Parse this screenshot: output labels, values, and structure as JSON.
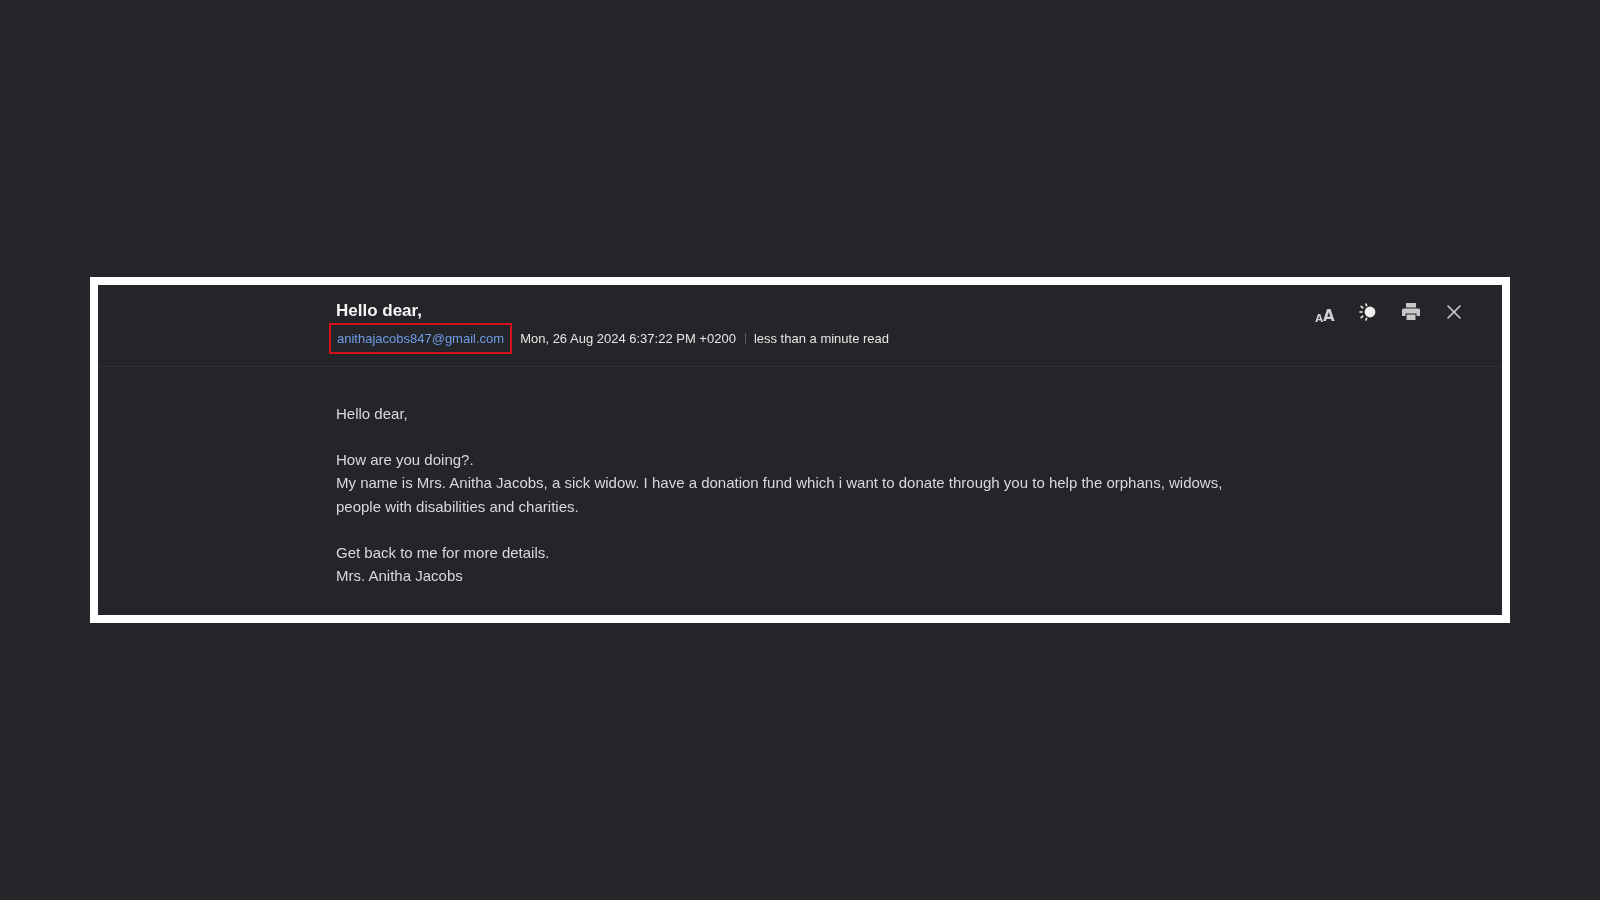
{
  "message": {
    "subject": "Hello dear,",
    "sender": {
      "email": "anithajacobs847@gmail.com",
      "highlighted": true
    },
    "date": "Mon, 26 Aug 2024 6:37:22 PM +0200",
    "read_time": "less than a minute read",
    "toolbar": [
      {
        "kind": "text_size",
        "small": "A",
        "large": "A"
      },
      {
        "kind": "theme"
      },
      {
        "kind": "print"
      },
      {
        "kind": "close"
      }
    ],
    "body": [
      {
        "lines": [
          "Hello dear,"
        ]
      },
      {
        "lines": [
          "How are you doing?.",
          "My name is Mrs. Anitha Jacobs, a sick widow. I have a donation fund which i want to donate through you to help the orphans, widows, people with disabilities and charities."
        ]
      },
      {
        "lines": [
          "Get back to me for more details.",
          "Mrs. Anitha Jacobs"
        ]
      }
    ]
  }
}
